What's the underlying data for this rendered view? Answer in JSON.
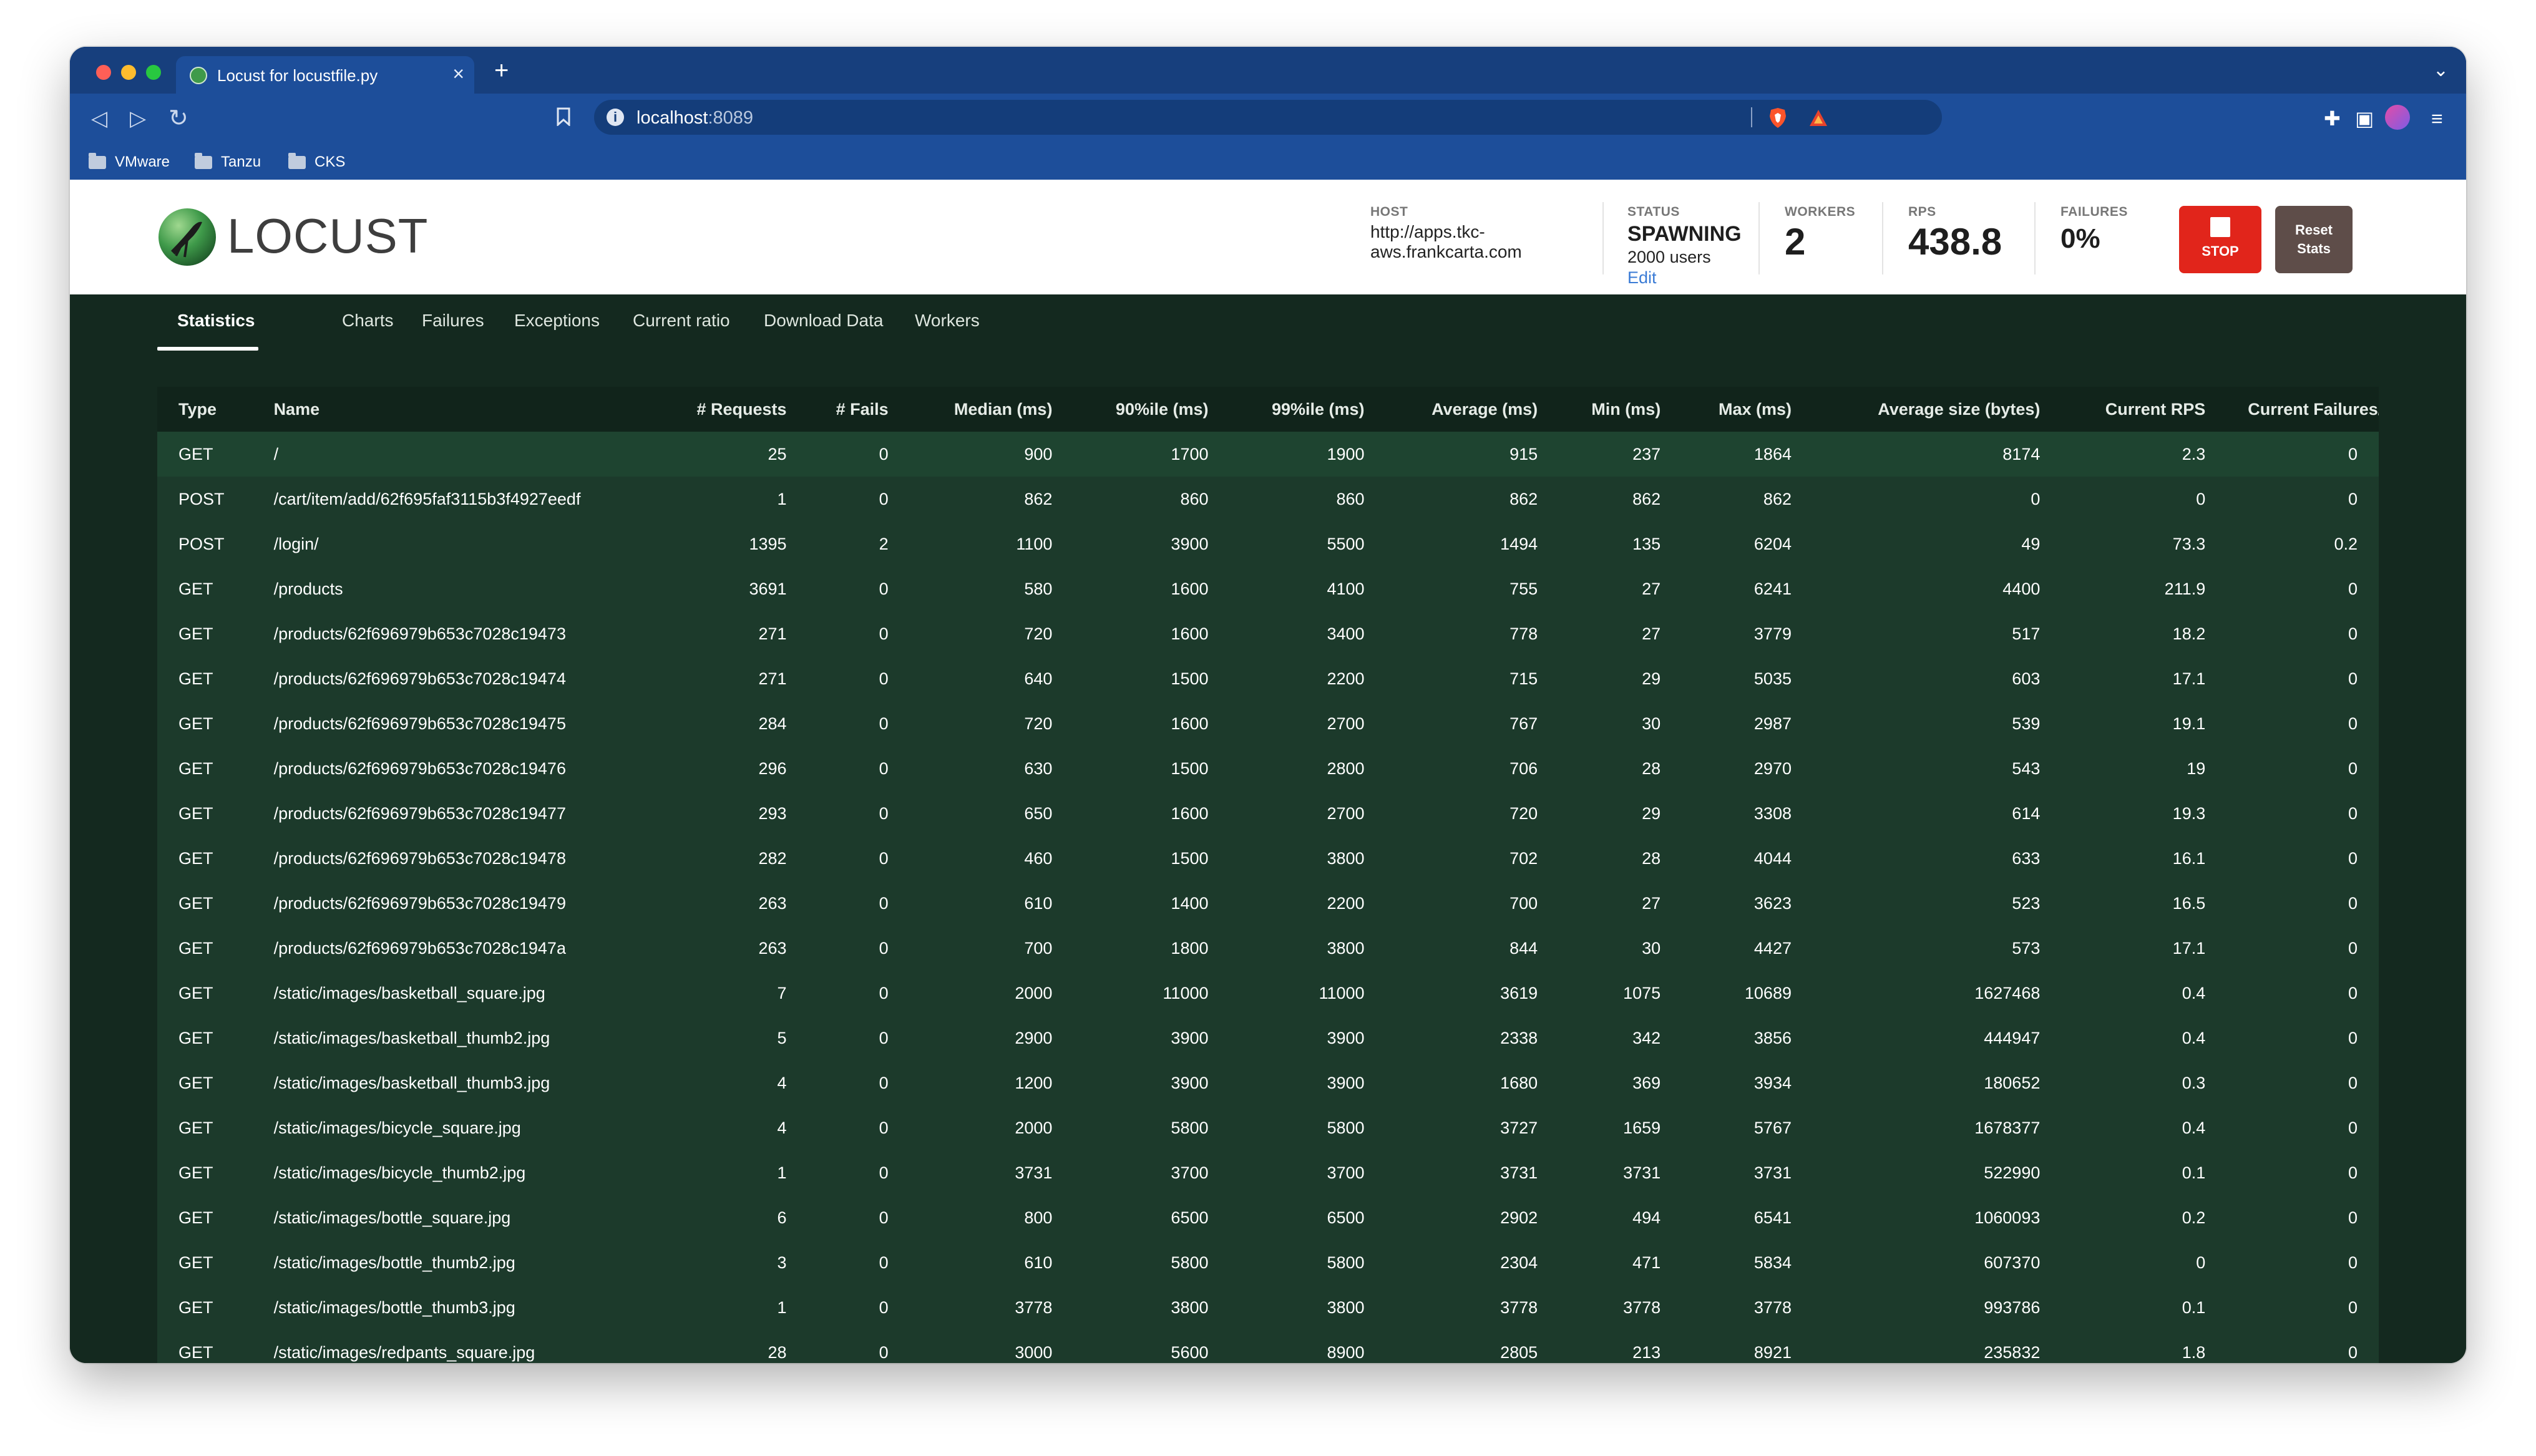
{
  "browser": {
    "tab_title": "Locust for locustfile.py",
    "url_host": "localhost",
    "url_port": ":8089",
    "bookmarks": [
      "VMware",
      "Tanzu",
      "CKS"
    ]
  },
  "app": {
    "logo_text": "LOCUST",
    "host_label": "HOST",
    "host_value": "http://apps.tkc-aws.frankcarta.com",
    "status_label": "STATUS",
    "status_value": "SPAWNING",
    "status_users": "2000 users",
    "status_edit": "Edit",
    "workers_label": "WORKERS",
    "workers_value": "2",
    "rps_label": "RPS",
    "rps_value": "438.8",
    "failures_label": "FAILURES",
    "failures_value": "0%",
    "stop_label": "STOP",
    "reset_label": "Reset Stats"
  },
  "tabs": [
    "Statistics",
    "Charts",
    "Failures",
    "Exceptions",
    "Current ratio",
    "Download Data",
    "Workers"
  ],
  "table": {
    "columns": [
      "Type",
      "Name",
      "# Requests",
      "# Fails",
      "Median (ms)",
      "90%ile (ms)",
      "99%ile (ms)",
      "Average (ms)",
      "Min (ms)",
      "Max (ms)",
      "Average size (bytes)",
      "Current RPS",
      "Current Failures/s"
    ],
    "rows": [
      [
        "GET",
        "/",
        "25",
        "0",
        "900",
        "1700",
        "1900",
        "915",
        "237",
        "1864",
        "8174",
        "2.3",
        "0"
      ],
      [
        "POST",
        "/cart/item/add/62f695faf3115b3f4927eedf",
        "1",
        "0",
        "862",
        "860",
        "860",
        "862",
        "862",
        "862",
        "0",
        "0",
        "0"
      ],
      [
        "POST",
        "/login/",
        "1395",
        "2",
        "1100",
        "3900",
        "5500",
        "1494",
        "135",
        "6204",
        "49",
        "73.3",
        "0.2"
      ],
      [
        "GET",
        "/products",
        "3691",
        "0",
        "580",
        "1600",
        "4100",
        "755",
        "27",
        "6241",
        "4400",
        "211.9",
        "0"
      ],
      [
        "GET",
        "/products/62f696979b653c7028c19473",
        "271",
        "0",
        "720",
        "1600",
        "3400",
        "778",
        "27",
        "3779",
        "517",
        "18.2",
        "0"
      ],
      [
        "GET",
        "/products/62f696979b653c7028c19474",
        "271",
        "0",
        "640",
        "1500",
        "2200",
        "715",
        "29",
        "5035",
        "603",
        "17.1",
        "0"
      ],
      [
        "GET",
        "/products/62f696979b653c7028c19475",
        "284",
        "0",
        "720",
        "1600",
        "2700",
        "767",
        "30",
        "2987",
        "539",
        "19.1",
        "0"
      ],
      [
        "GET",
        "/products/62f696979b653c7028c19476",
        "296",
        "0",
        "630",
        "1500",
        "2800",
        "706",
        "28",
        "2970",
        "543",
        "19",
        "0"
      ],
      [
        "GET",
        "/products/62f696979b653c7028c19477",
        "293",
        "0",
        "650",
        "1600",
        "2700",
        "720",
        "29",
        "3308",
        "614",
        "19.3",
        "0"
      ],
      [
        "GET",
        "/products/62f696979b653c7028c19478",
        "282",
        "0",
        "460",
        "1500",
        "3800",
        "702",
        "28",
        "4044",
        "633",
        "16.1",
        "0"
      ],
      [
        "GET",
        "/products/62f696979b653c7028c19479",
        "263",
        "0",
        "610",
        "1400",
        "2200",
        "700",
        "27",
        "3623",
        "523",
        "16.5",
        "0"
      ],
      [
        "GET",
        "/products/62f696979b653c7028c1947a",
        "263",
        "0",
        "700",
        "1800",
        "3800",
        "844",
        "30",
        "4427",
        "573",
        "17.1",
        "0"
      ],
      [
        "GET",
        "/static/images/basketball_square.jpg",
        "7",
        "0",
        "2000",
        "11000",
        "11000",
        "3619",
        "1075",
        "10689",
        "1627468",
        "0.4",
        "0"
      ],
      [
        "GET",
        "/static/images/basketball_thumb2.jpg",
        "5",
        "0",
        "2900",
        "3900",
        "3900",
        "2338",
        "342",
        "3856",
        "444947",
        "0.4",
        "0"
      ],
      [
        "GET",
        "/static/images/basketball_thumb3.jpg",
        "4",
        "0",
        "1200",
        "3900",
        "3900",
        "1680",
        "369",
        "3934",
        "180652",
        "0.3",
        "0"
      ],
      [
        "GET",
        "/static/images/bicycle_square.jpg",
        "4",
        "0",
        "2000",
        "5800",
        "5800",
        "3727",
        "1659",
        "5767",
        "1678377",
        "0.4",
        "0"
      ],
      [
        "GET",
        "/static/images/bicycle_thumb2.jpg",
        "1",
        "0",
        "3731",
        "3700",
        "3700",
        "3731",
        "3731",
        "3731",
        "522990",
        "0.1",
        "0"
      ],
      [
        "GET",
        "/static/images/bottle_square.jpg",
        "6",
        "0",
        "800",
        "6500",
        "6500",
        "2902",
        "494",
        "6541",
        "1060093",
        "0.2",
        "0"
      ],
      [
        "GET",
        "/static/images/bottle_thumb2.jpg",
        "3",
        "0",
        "610",
        "5800",
        "5800",
        "2304",
        "471",
        "5834",
        "607370",
        "0",
        "0"
      ],
      [
        "GET",
        "/static/images/bottle_thumb3.jpg",
        "1",
        "0",
        "3778",
        "3800",
        "3800",
        "3778",
        "3778",
        "3778",
        "993786",
        "0.1",
        "0"
      ],
      [
        "GET",
        "/static/images/redpants_square.jpg",
        "28",
        "0",
        "3000",
        "5600",
        "8900",
        "2805",
        "213",
        "8921",
        "235832",
        "1.8",
        "0"
      ]
    ]
  }
}
